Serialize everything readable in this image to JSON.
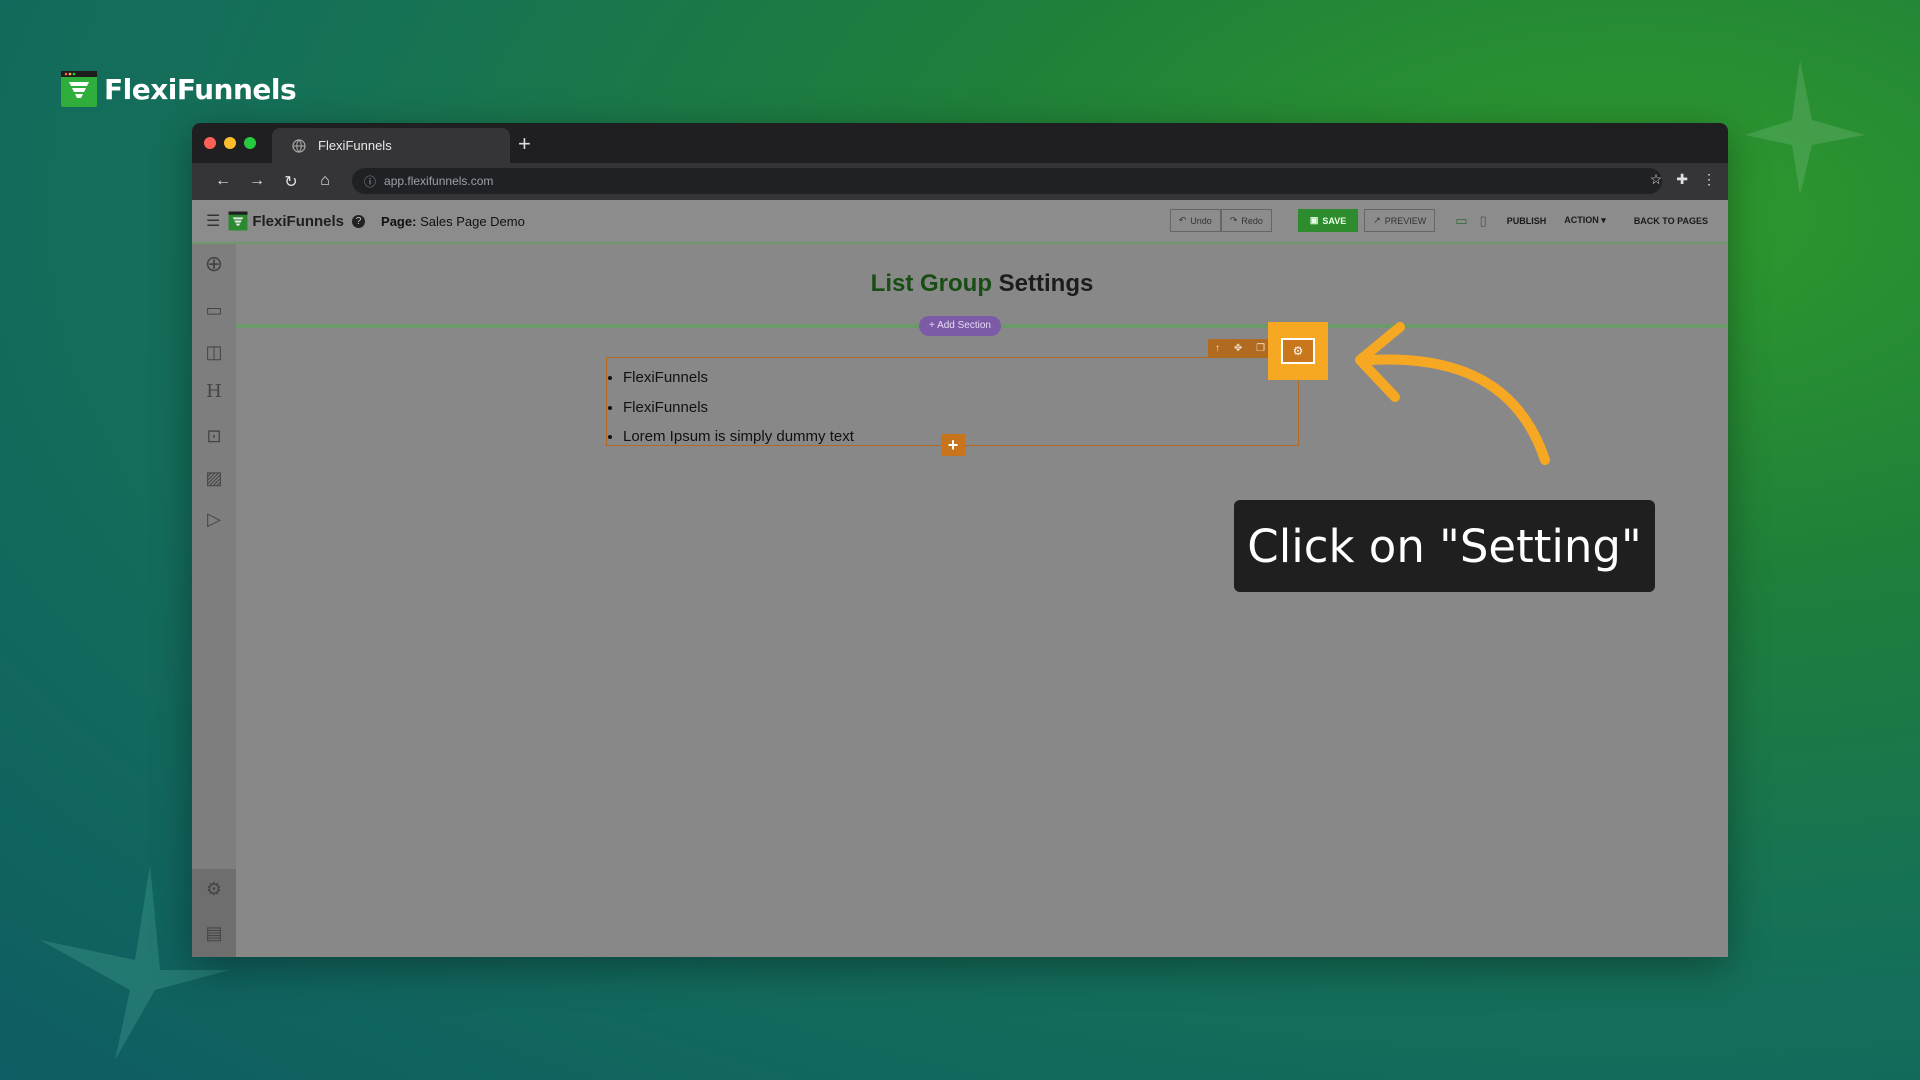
{
  "brand": {
    "name": "FlexiFunnels"
  },
  "browser": {
    "tab_title": "FlexiFunnels",
    "new_tab": "+",
    "url": "app.flexifunnels.com"
  },
  "app": {
    "logo": "FlexiFunnels",
    "page_label": "Page:",
    "page_name": "Sales Page Demo",
    "toolbar": {
      "undo": "Undo",
      "redo": "Redo",
      "save": "SAVE",
      "preview": "PREVIEW",
      "publish": "PUBLISH",
      "action": "ACTION",
      "back": "BACK TO PAGES"
    }
  },
  "canvas": {
    "title_green": "List Group",
    "title_rest": " Settings",
    "add_section": "+ Add Section",
    "list_items": [
      "FlexiFunnels",
      "FlexiFunnels",
      "Lorem Ipsum is simply dummy text"
    ]
  },
  "callout": {
    "text": "Click on \"Setting\""
  },
  "colors": {
    "accent_orange": "#f7a823",
    "save_green": "#2e8b2e",
    "add_section_purple": "#7b5aa6"
  },
  "icons": {
    "sidebar": [
      "add-circle-icon",
      "section-icon",
      "columns-icon",
      "heading-icon",
      "text-icon",
      "image-icon",
      "video-icon",
      "settings-icon",
      "preview-icon"
    ]
  }
}
